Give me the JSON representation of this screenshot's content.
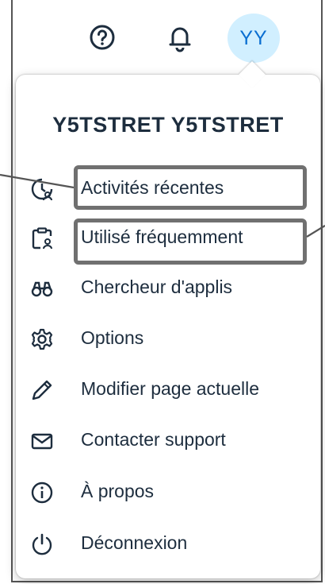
{
  "header": {
    "avatar_initials": "YY",
    "icons": [
      "help-icon",
      "notification-bell-icon"
    ]
  },
  "user_menu": {
    "user_name": "Y5TSTRET Y5TSTRET",
    "items": [
      {
        "label": "Activités récentes",
        "icon": "recent-activity-icon"
      },
      {
        "label": "Utilisé fréquemment",
        "icon": "frequently-used-icon"
      },
      {
        "label": "Chercheur d'applis",
        "icon": "binoculars-icon"
      },
      {
        "label": "Options",
        "icon": "settings-icon"
      },
      {
        "label": "Modifier page actuelle",
        "icon": "edit-icon"
      },
      {
        "label": "Contacter support",
        "icon": "email-icon"
      },
      {
        "label": "À propos",
        "icon": "info-icon"
      },
      {
        "label": "Déconnexion",
        "icon": "power-icon"
      }
    ]
  },
  "colors": {
    "accent": "#0a6ed1",
    "avatar_bg": "#d1efff",
    "text": "#1d2d3e",
    "highlight_border": "#707070"
  }
}
